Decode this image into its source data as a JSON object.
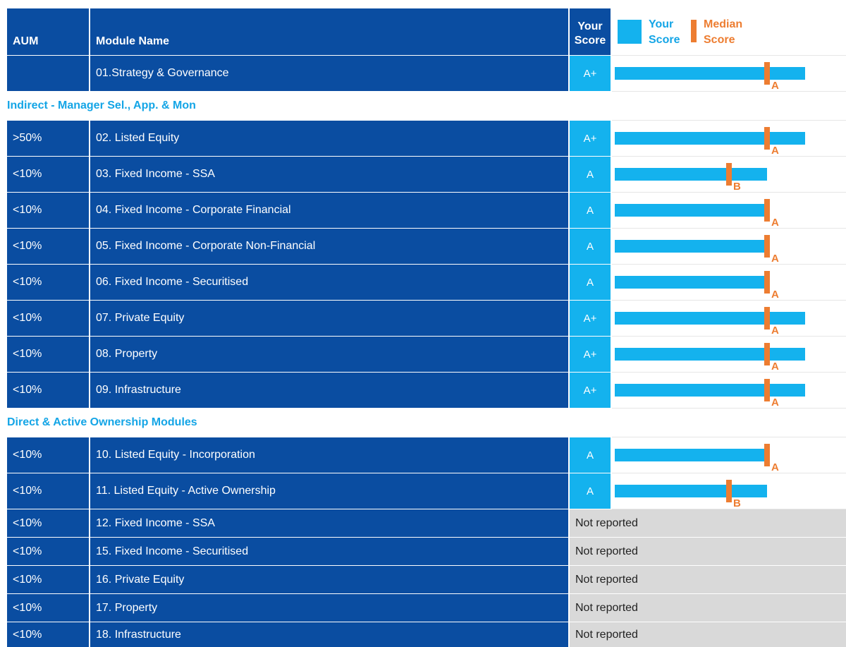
{
  "header": {
    "aum": "AUM",
    "module": "Module Name",
    "score_line1": "Your",
    "score_line2": "Score"
  },
  "legend": {
    "your_line1": "Your",
    "your_line2": "Score",
    "median_line1": "Median",
    "median_line2": "Score"
  },
  "sections": [
    "Indirect - Manager Sel., App. & Mon",
    "Direct & Active Ownership Modules"
  ],
  "rows": [
    {
      "aum": "",
      "module": "01.Strategy & Governance",
      "score": "A+"
    },
    {
      "aum": ">50%",
      "module": "02. Listed Equity",
      "score": "A+"
    },
    {
      "aum": "<10%",
      "module": "03. Fixed Income - SSA",
      "score": "A"
    },
    {
      "aum": "<10%",
      "module": "04. Fixed Income - Corporate Financial",
      "score": "A"
    },
    {
      "aum": "<10%",
      "module": "05. Fixed Income - Corporate Non-Financial",
      "score": "A"
    },
    {
      "aum": "<10%",
      "module": "06. Fixed Income - Securitised",
      "score": "A"
    },
    {
      "aum": "<10%",
      "module": "07. Private Equity",
      "score": "A+"
    },
    {
      "aum": "<10%",
      "module": "08. Property",
      "score": "A+"
    },
    {
      "aum": "<10%",
      "module": "09. Infrastructure",
      "score": "A+"
    },
    {
      "aum": "<10%",
      "module": "10. Listed Equity - Incorporation",
      "score": "A"
    },
    {
      "aum": "<10%",
      "module": "11. Listed Equity - Active Ownership",
      "score": "A"
    },
    {
      "aum": "<10%",
      "module": "12. Fixed Income - SSA",
      "status": "Not reported"
    },
    {
      "aum": "<10%",
      "module": "15. Fixed Income - Securitised",
      "status": "Not reported"
    },
    {
      "aum": "<10%",
      "module": "16. Private Equity",
      "status": "Not reported"
    },
    {
      "aum": "<10%",
      "module": "17. Property",
      "status": "Not reported"
    },
    {
      "aum": "<10%",
      "module": "18. Infrastructure",
      "status": "Not reported"
    }
  ],
  "colors": {
    "dark_blue": "#0a4da1",
    "score_blue": "#14b2ee",
    "median_orange": "#ed7d31",
    "not_reported_gray": "#d9d9d9"
  },
  "chart_data": {
    "type": "bar",
    "categories": [
      "01.Strategy & Governance",
      "02. Listed Equity",
      "03. Fixed Income - SSA",
      "04. Fixed Income - Corporate Financial",
      "05. Fixed Income - Corporate Non-Financial",
      "06. Fixed Income - Securitised",
      "07. Private Equity",
      "08. Property",
      "09. Infrastructure",
      "10. Listed Equity - Incorporation",
      "11. Listed Equity - Active Ownership"
    ],
    "grade_scale": [
      "E",
      "D",
      "C",
      "B",
      "A",
      "A+"
    ],
    "series": [
      {
        "name": "Your Score",
        "values": [
          "A+",
          "A+",
          "A",
          "A",
          "A",
          "A",
          "A+",
          "A+",
          "A+",
          "A",
          "A"
        ]
      },
      {
        "name": "Median Score",
        "values": [
          "A",
          "A",
          "B",
          "A",
          "A",
          "A",
          "A",
          "A",
          "A",
          "A",
          "B"
        ]
      }
    ],
    "orientation": "horizontal",
    "grid": false,
    "legend": "top"
  }
}
